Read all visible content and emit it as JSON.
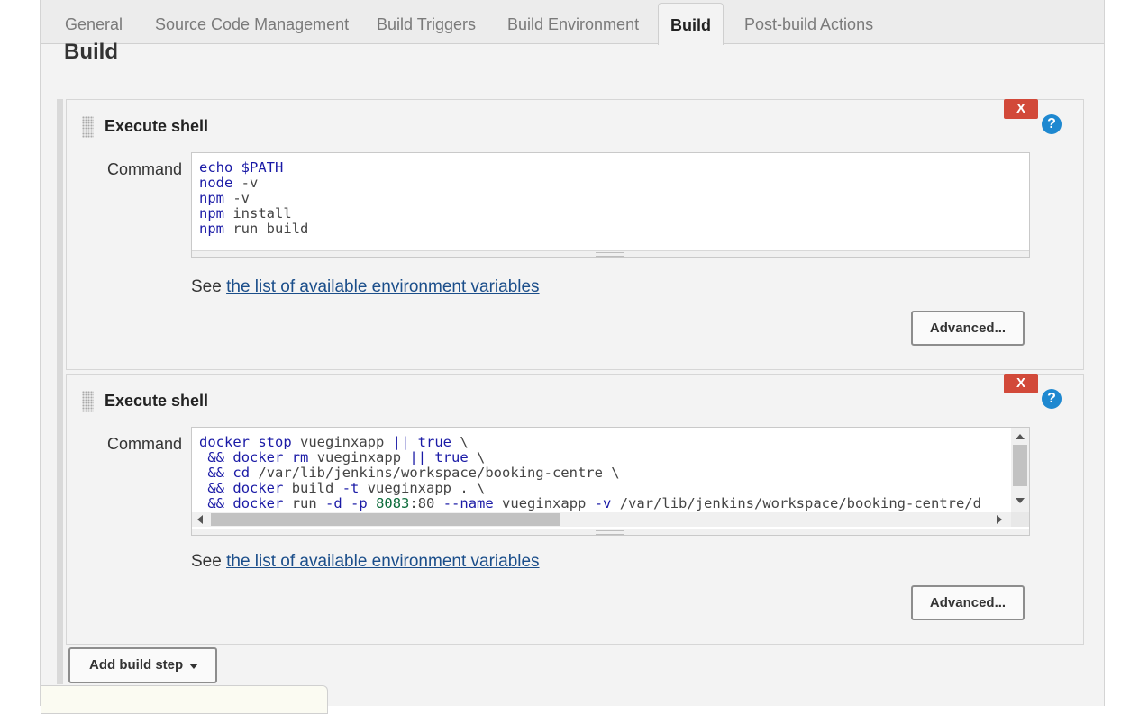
{
  "tabs": [
    {
      "label": "General"
    },
    {
      "label": "Source Code Management"
    },
    {
      "label": "Build Triggers"
    },
    {
      "label": "Build Environment"
    },
    {
      "label": "Build"
    },
    {
      "label": "Post-build Actions"
    }
  ],
  "active_tab": "Build",
  "section_title": "Build",
  "steps": [
    {
      "title": "Execute shell",
      "delete_label": "X",
      "help_label": "?",
      "command_label": "Command",
      "command_lines": [
        "echo $PATH",
        "node -v",
        "npm -v",
        "npm install",
        "npm run build"
      ],
      "see_prefix": "See",
      "env_link": "the list of available environment variables",
      "advanced_label": "Advanced..."
    },
    {
      "title": "Execute shell",
      "delete_label": "X",
      "help_label": "?",
      "command_label": "Command",
      "command_lines": [
        "docker stop vueginxapp || true \\",
        " && docker rm vueginxapp || true \\",
        " && cd /var/lib/jenkins/workspace/booking-centre \\",
        " && docker build -t vueginxapp . \\",
        " && docker run -d -p 8083:80 --name vueginxapp -v /var/lib/jenkins/workspace/booking-centre/d"
      ],
      "see_prefix": "See",
      "env_link": "the list of available environment variables",
      "advanced_label": "Advanced..."
    }
  ],
  "add_build_step_label": "Add build step",
  "colors": {
    "delete_button": "#d24939",
    "help_icon": "#1e88d0",
    "link": "#1b4e8a",
    "panel_bg": "#f3f3f3"
  }
}
